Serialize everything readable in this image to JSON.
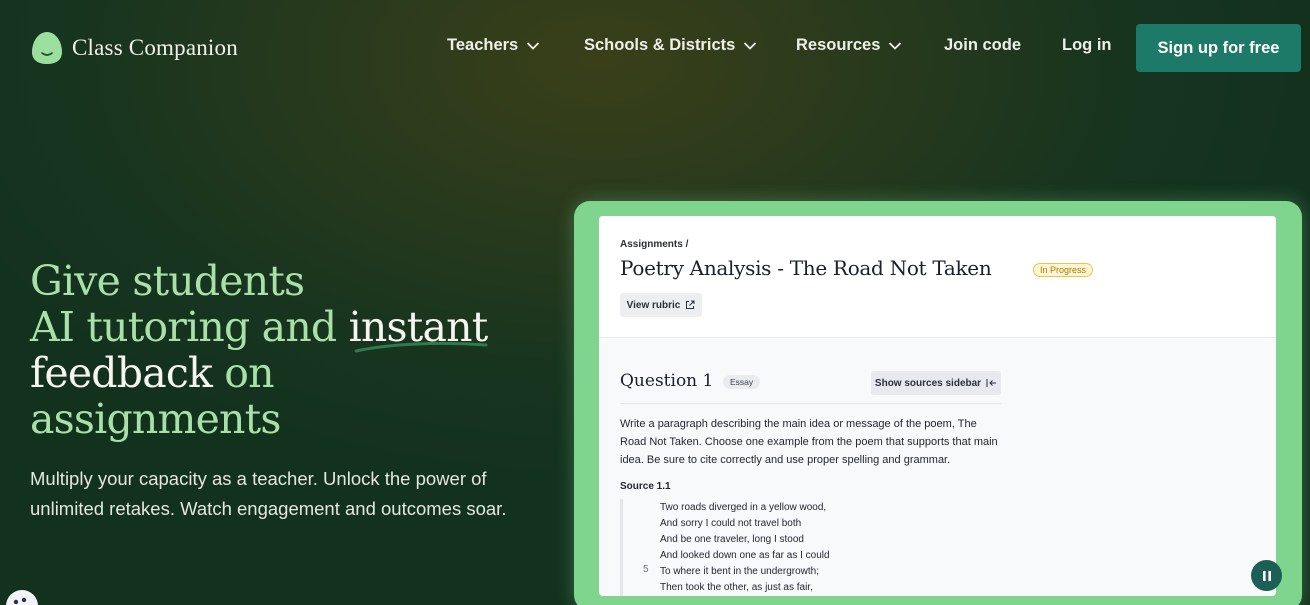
{
  "nav": {
    "brand": "Class Companion",
    "items": [
      {
        "label": "Teachers",
        "has_dropdown": true
      },
      {
        "label": "Schools & Districts",
        "has_dropdown": true
      },
      {
        "label": "Resources",
        "has_dropdown": true
      },
      {
        "label": "Join code",
        "has_dropdown": false
      },
      {
        "label": "Log in",
        "has_dropdown": false
      }
    ],
    "cta": "Sign up for free"
  },
  "hero": {
    "title_l1": "Give students",
    "title_l2a": "AI tutoring and ",
    "title_l2b": "instant",
    "title_l3a": "feedback",
    "title_l3b": " on",
    "title_l4": "assignments",
    "subtitle": "Multiply your capacity as a teacher. Unlock the power of unlimited retakes. Watch engagement and outcomes soar."
  },
  "mock": {
    "breadcrumb": "Assignments /",
    "title": "Poetry Analysis - The Road Not Taken",
    "status": "In Progress",
    "rubric_button": "View rubric",
    "question_title": "Question 1",
    "question_type": "Essay",
    "sources_button": "Show sources sidebar",
    "prompt": "Write a paragraph describing the main idea or message of the poem, The Road Not Taken. Choose one example from the poem that supports that main idea. Be sure to cite correctly and use proper spelling and grammar.",
    "source_label": "Source 1.1",
    "poem_lines": [
      "Two roads diverged in a yellow wood,",
      "And sorry I could not travel both",
      "And be one traveler, long I stood",
      "And looked down one as far as I could",
      "To where it bent in the undergrowth;",
      "Then took the other, as just as fair,"
    ],
    "line_number": "5"
  },
  "colors": {
    "accent": "#1e7a68",
    "hero_green": "#a8e0a7",
    "card_glow": "#7fd48e",
    "badge_yellow": "#f0c24b"
  }
}
